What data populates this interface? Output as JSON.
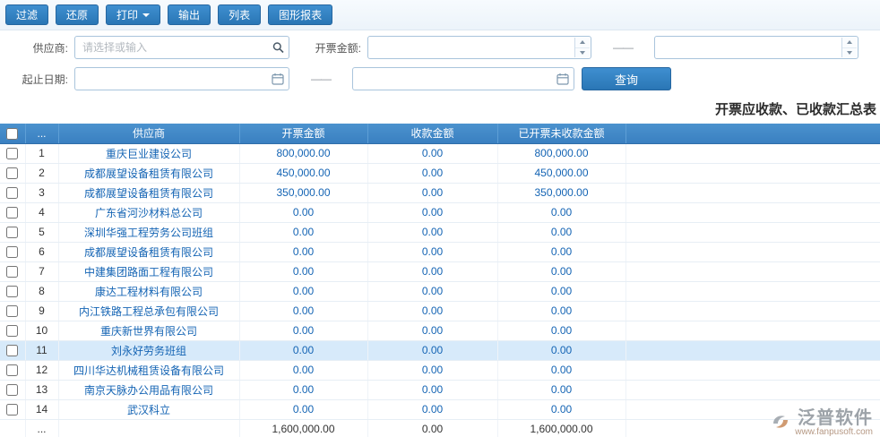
{
  "toolbar": {
    "buttons": [
      {
        "label": "过滤"
      },
      {
        "label": "还原"
      },
      {
        "label": "打印"
      },
      {
        "label": "输出"
      },
      {
        "label": "列表"
      },
      {
        "label": "图形报表"
      }
    ]
  },
  "filters": {
    "supplier_label": "供应商:",
    "supplier_placeholder": "请选择或输入",
    "invoice_amount_label": "开票金额:",
    "amount_min_value": "",
    "amount_max_value": "",
    "date_label": "起止日期:",
    "start_date_value": "",
    "end_date_value": "",
    "range_dash": "——",
    "query_button": "查询"
  },
  "report": {
    "title": "开票应收款、已收款汇总表"
  },
  "table": {
    "columns": [
      "",
      "...",
      "供应商",
      "开票金额",
      "收款金额",
      "已开票未收款金额",
      ""
    ],
    "rows": [
      {
        "index": "1",
        "supplier": "重庆巨业建设公司",
        "invoice": "800,000.00",
        "received": "0.00",
        "unreceived": "800,000.00"
      },
      {
        "index": "2",
        "supplier": "成都展望设备租赁有限公司",
        "invoice": "450,000.00",
        "received": "0.00",
        "unreceived": "450,000.00"
      },
      {
        "index": "3",
        "supplier": "成都展望设备租赁有限公司",
        "invoice": "350,000.00",
        "received": "0.00",
        "unreceived": "350,000.00"
      },
      {
        "index": "4",
        "supplier": "广东省河沙材料总公司",
        "invoice": "0.00",
        "received": "0.00",
        "unreceived": "0.00"
      },
      {
        "index": "5",
        "supplier": "深圳华强工程劳务公司班组",
        "invoice": "0.00",
        "received": "0.00",
        "unreceived": "0.00"
      },
      {
        "index": "6",
        "supplier": "成都展望设备租赁有限公司",
        "invoice": "0.00",
        "received": "0.00",
        "unreceived": "0.00"
      },
      {
        "index": "7",
        "supplier": "中建集团路面工程有限公司",
        "invoice": "0.00",
        "received": "0.00",
        "unreceived": "0.00"
      },
      {
        "index": "8",
        "supplier": "康达工程材料有限公司",
        "invoice": "0.00",
        "received": "0.00",
        "unreceived": "0.00"
      },
      {
        "index": "9",
        "supplier": "内江铁路工程总承包有限公司",
        "invoice": "0.00",
        "received": "0.00",
        "unreceived": "0.00"
      },
      {
        "index": "10",
        "supplier": "重庆新世界有限公司",
        "invoice": "0.00",
        "received": "0.00",
        "unreceived": "0.00"
      },
      {
        "index": "11",
        "supplier": "刘永好劳务班组",
        "invoice": "0.00",
        "received": "0.00",
        "unreceived": "0.00",
        "selected": true
      },
      {
        "index": "12",
        "supplier": "四川华达机械租赁设备有限公司",
        "invoice": "0.00",
        "received": "0.00",
        "unreceived": "0.00"
      },
      {
        "index": "13",
        "supplier": "南京天脉办公用品有限公司",
        "invoice": "0.00",
        "received": "0.00",
        "unreceived": "0.00"
      },
      {
        "index": "14",
        "supplier": "武汉科立",
        "invoice": "0.00",
        "received": "0.00",
        "unreceived": "0.00"
      }
    ],
    "footer": {
      "index": "...",
      "supplier": "",
      "invoice": "1,600,000.00",
      "received": "0.00",
      "unreceived": "1,600,000.00"
    }
  },
  "watermark": {
    "title": "泛普软件",
    "url": "www.fanpusoft.com"
  },
  "colors": {
    "accent": "#2f7cbd",
    "header_blue": "#3a80c1",
    "link_blue": "#1464b4",
    "selected_row": "#d7eafa"
  }
}
